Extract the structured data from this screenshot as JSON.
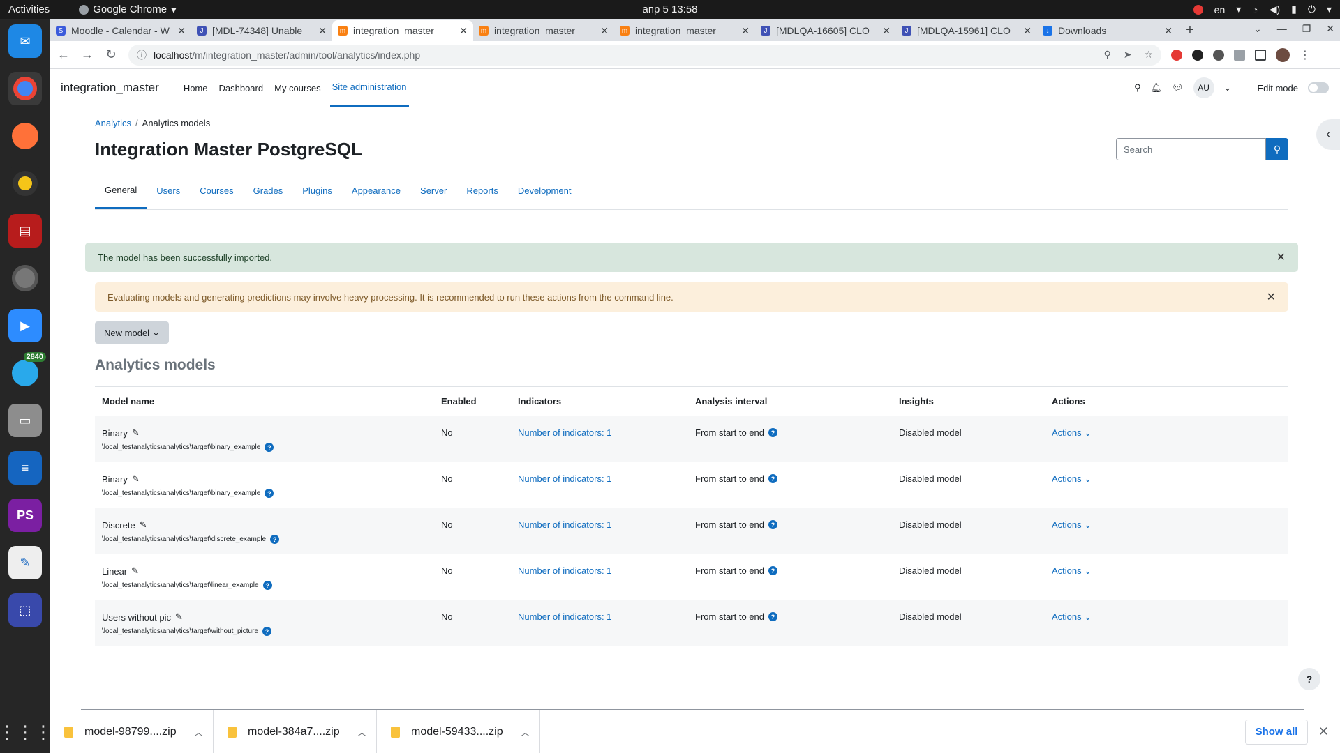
{
  "os": {
    "activities": "Activities",
    "app_name": "Google Chrome",
    "clock": "апр 5  13:58",
    "lang": "en"
  },
  "dock": {
    "telegram_badge": "2840"
  },
  "browser": {
    "tabs": [
      {
        "title": "Moodle - Calendar - W",
        "fav": "S",
        "color": "#3b5bdb"
      },
      {
        "title": "[MDL-74348] Unable",
        "fav": "J",
        "color": "#3f51b5"
      },
      {
        "title": "integration_master",
        "fav": "m",
        "color": "#f98012",
        "active": true
      },
      {
        "title": "integration_master",
        "fav": "m",
        "color": "#f98012"
      },
      {
        "title": "integration_master",
        "fav": "m",
        "color": "#f98012"
      },
      {
        "title": "[MDLQA-16605] CLO",
        "fav": "J",
        "color": "#3f51b5"
      },
      {
        "title": "[MDLQA-15961] CLO",
        "fav": "J",
        "color": "#3f51b5"
      },
      {
        "title": "Downloads",
        "fav": "↓",
        "color": "#1a73e8"
      }
    ],
    "url_host": "localhost",
    "url_path": "/m/integration_master/admin/tool/analytics/index.php"
  },
  "moodle": {
    "brand": "integration_master",
    "nav": [
      "Home",
      "Dashboard",
      "My courses",
      "Site administration"
    ],
    "user_initials": "AU",
    "edit_mode": "Edit mode",
    "breadcrumb": [
      "Analytics",
      "Analytics models"
    ],
    "page_title": "Integration Master PostgreSQL",
    "search_placeholder": "Search",
    "admin_tabs": [
      "General",
      "Users",
      "Courses",
      "Grades",
      "Plugins",
      "Appearance",
      "Server",
      "Reports",
      "Development"
    ],
    "success_msg": "The model has been successfully imported.",
    "warning_msg": "Evaluating models and generating predictions may involve heavy processing. It is recommended to run these actions from the command line.",
    "new_model": "New model",
    "section_title": "Analytics models",
    "table": {
      "headers": [
        "Model name",
        "Enabled",
        "Indicators",
        "Analysis interval",
        "Insights",
        "Actions"
      ],
      "rows": [
        {
          "name": "Binary",
          "target": "\\local_testanalytics\\analytics\\target\\binary_example",
          "enabled": "No",
          "indicators": "Number of indicators: 1",
          "interval": "From start to end",
          "insights": "Disabled model",
          "actions": "Actions"
        },
        {
          "name": "Binary",
          "target": "\\local_testanalytics\\analytics\\target\\binary_example",
          "enabled": "No",
          "indicators": "Number of indicators: 1",
          "interval": "From start to end",
          "insights": "Disabled model",
          "actions": "Actions"
        },
        {
          "name": "Discrete",
          "target": "\\local_testanalytics\\analytics\\target\\discrete_example",
          "enabled": "No",
          "indicators": "Number of indicators: 1",
          "interval": "From start to end",
          "insights": "Disabled model",
          "actions": "Actions"
        },
        {
          "name": "Linear",
          "target": "\\local_testanalytics\\analytics\\target\\linear_example",
          "enabled": "No",
          "indicators": "Number of indicators: 1",
          "interval": "From start to end",
          "insights": "Disabled model",
          "actions": "Actions"
        },
        {
          "name": "Users without pic",
          "target": "\\local_testanalytics\\analytics\\target\\without_picture",
          "enabled": "No",
          "indicators": "Number of indicators: 1",
          "interval": "From start to end",
          "insights": "Disabled model",
          "actions": "Actions"
        }
      ]
    }
  },
  "downloads": {
    "files": [
      "model-98799....zip",
      "model-384a7....zip",
      "model-59433....zip"
    ],
    "show_all": "Show all"
  }
}
